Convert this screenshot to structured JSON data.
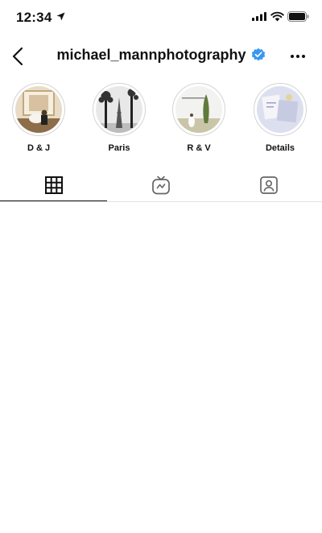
{
  "status_bar": {
    "time": "12:34",
    "icons": [
      "location-arrow-icon",
      "cellular-signal-icon",
      "wifi-icon",
      "battery-icon"
    ]
  },
  "header": {
    "username": "michael_mannphotography",
    "verified": true,
    "icons": [
      "back-chevron-icon",
      "verified-badge-icon",
      "more-options-icon"
    ],
    "colors": {
      "verified": "#3897f0"
    }
  },
  "highlights": [
    {
      "label": "D & J"
    },
    {
      "label": "Paris"
    },
    {
      "label": "R & V"
    },
    {
      "label": "Details"
    }
  ],
  "tabs": [
    {
      "icon": "grid-icon",
      "active": true
    },
    {
      "icon": "igtv-icon",
      "active": false
    },
    {
      "icon": "tagged-person-icon",
      "active": false
    }
  ]
}
